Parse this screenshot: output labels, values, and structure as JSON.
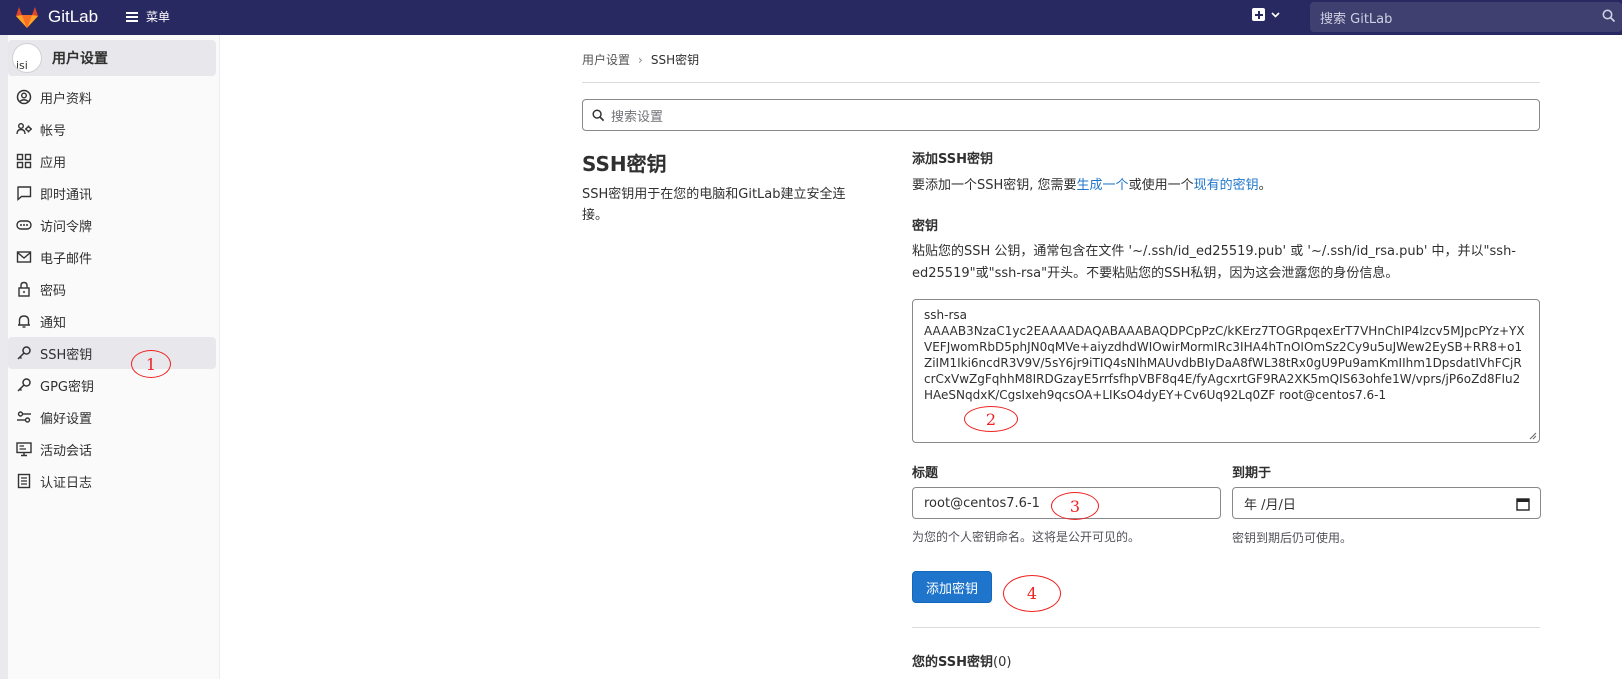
{
  "app": {
    "brand": "GitLab",
    "menu_label": "菜单",
    "search_placeholder": "搜索 GitLab"
  },
  "sidebar": {
    "header": {
      "label": "用户设置",
      "avatar_text": "isi"
    },
    "items": [
      {
        "label": "用户资料",
        "icon": "profile-icon",
        "active": false
      },
      {
        "label": "帐号",
        "icon": "account-icon",
        "active": false
      },
      {
        "label": "应用",
        "icon": "applications-icon",
        "active": false
      },
      {
        "label": "即时通讯",
        "icon": "chat-icon",
        "active": false
      },
      {
        "label": "访问令牌",
        "icon": "token-icon",
        "active": false
      },
      {
        "label": "电子邮件",
        "icon": "mail-icon",
        "active": false
      },
      {
        "label": "密码",
        "icon": "lock-icon",
        "active": false
      },
      {
        "label": "通知",
        "icon": "bell-icon",
        "active": false
      },
      {
        "label": "SSH密钥",
        "icon": "key-icon",
        "active": true
      },
      {
        "label": "GPG密钥",
        "icon": "key-icon",
        "active": false
      },
      {
        "label": "偏好设置",
        "icon": "preferences-icon",
        "active": false
      },
      {
        "label": "活动会话",
        "icon": "monitor-icon",
        "active": false
      },
      {
        "label": "认证日志",
        "icon": "log-icon",
        "active": false
      }
    ]
  },
  "breadcrumb": {
    "parent": "用户设置",
    "separator": "›",
    "current": "SSH密钥"
  },
  "settings_search": {
    "placeholder": "搜索设置"
  },
  "section": {
    "title": "SSH密钥",
    "description": "SSH密钥用于在您的电脑和GitLab建立安全连接。"
  },
  "add_key": {
    "heading": "添加SSH密钥",
    "intro_before": "要添加一个SSH密钥, 您需要",
    "intro_link1": "生成一个",
    "intro_middle": "或使用一个",
    "intro_link2": "现有的密钥",
    "intro_after": "。",
    "key_label": "密钥",
    "key_help": "粘贴您的SSH 公钥，通常包含在文件 '~/.ssh/id_ed25519.pub' 或 '~/.ssh/id_rsa.pub' 中，并以\"ssh-ed25519\"或\"ssh-rsa\"开头。不要粘贴您的SSH私钥，因为这会泄露您的身份信息。",
    "key_value_line1": "ssh-rsa",
    "key_value": "AAAAB3NzaC1yc2EAAAADAQABAAABAQDPCpPzC/kKErz7TOGRpqexErT7VHnChIP4lzcv5MJpcPYz+YXVEFJwomRbD5phJN0qMVe+aiyzdhdWIOwirMormIRc3IHA4hTnOIOmSz2Cy9u5uJWew2EySB+RR8+o1ZiIM1Iki6ncdR3V9V/5sY6jr9iTIQ4sNIhMAUvdbBIyDaA8fWL38tRx0gU9Pu9amKmIIhm1DpsdatIVhFCjRcrCxVwZgFqhhM8IRDGzayE5rrfsfhpVBF8q4E/fyAgcxrtGF9RA2XK5mQIS63ohfe1W/vprs/jP6oZd8FIu2HAeSNqdxK/CgsIxeh9qcsOA+LIKsO4dyEY+Cv6Uq92Lq0ZF root@centos7.6-1",
    "title_label": "标题",
    "title_value": "root@centos7.6-1",
    "title_help": "为您的个人密钥命名。这将是公开可见的。",
    "expires_label": "到期于",
    "expires_value": "年 /月/日",
    "expires_help": "密钥到期后仍可使用。",
    "submit_label": "添加密钥",
    "your_keys_label": "您的SSH密钥",
    "your_keys_count": "(0)"
  },
  "annotations": [
    "1",
    "2",
    "3",
    "4"
  ],
  "colors": {
    "topbar": "#292961",
    "primary": "#1f75cb",
    "annotation": "#e22222"
  }
}
